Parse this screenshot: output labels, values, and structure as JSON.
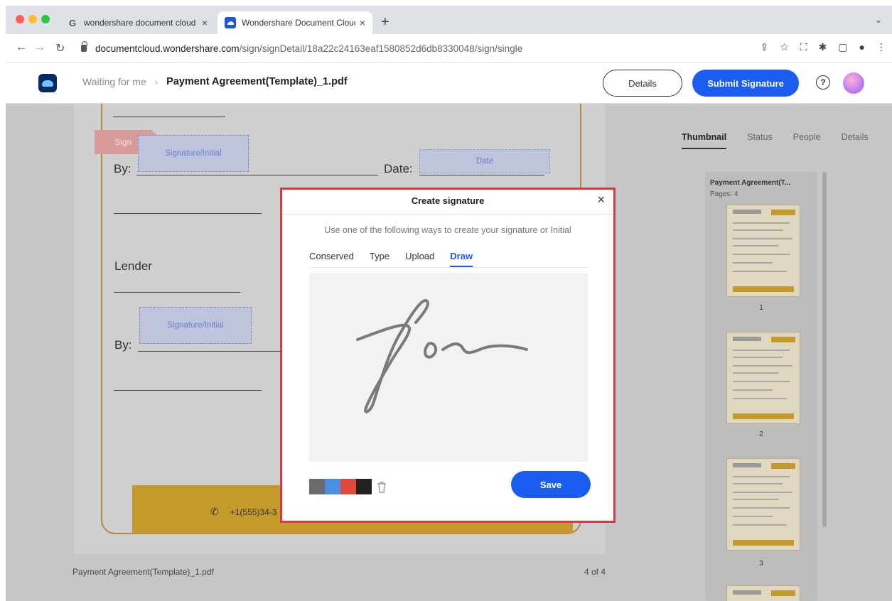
{
  "browser": {
    "tabs": [
      {
        "title": "wondershare document cloud",
        "favicon": "G"
      },
      {
        "title": "Wondershare Document Cloud"
      }
    ],
    "new_tab": "+",
    "url_domain": "documentcloud.wondershare.com",
    "url_path": "/sign/signDetail/18a22c24163eaf1580852d6db8330048/sign/single"
  },
  "header": {
    "breadcrumb_parent": "Waiting for me",
    "breadcrumb_sep": "›",
    "file_name": "Payment Agreement(Template)_1.pdf",
    "details_label": "Details",
    "submit_label": "Submit Signature",
    "help": "?"
  },
  "document": {
    "sign_tag": "Sign",
    "by_label": "By:",
    "by_label_2": "By:",
    "date_label": "Date:",
    "lender_label": "Lender",
    "signature_field_1": "Signature/Initial",
    "signature_field_2": "Signature/Initial",
    "date_field": "Date",
    "phone": "+1(555)34-3",
    "footer_file": "Payment Agreement(Template)_1.pdf",
    "footer_pages": "4 of 4"
  },
  "panel": {
    "tabs": [
      "Thumbnail",
      "Status",
      "People",
      "Details"
    ],
    "active_tab": "Thumbnail",
    "doc_title": "Payment Agreement(T...",
    "pages_label": "Pages: 4",
    "page_numbers": [
      "1",
      "2",
      "3"
    ]
  },
  "modal": {
    "title": "Create signature",
    "close": "×",
    "subtitle": "Use one of the following ways to create your signature or Initial",
    "tabs": [
      "Conserved",
      "Type",
      "Upload",
      "Draw"
    ],
    "active_tab": "Draw",
    "save_label": "Save",
    "swatch_colors": [
      "#6b6b6b",
      "#4a90e2",
      "#e04a3c",
      "#222222"
    ],
    "ink_color": "#7a7a7a"
  }
}
